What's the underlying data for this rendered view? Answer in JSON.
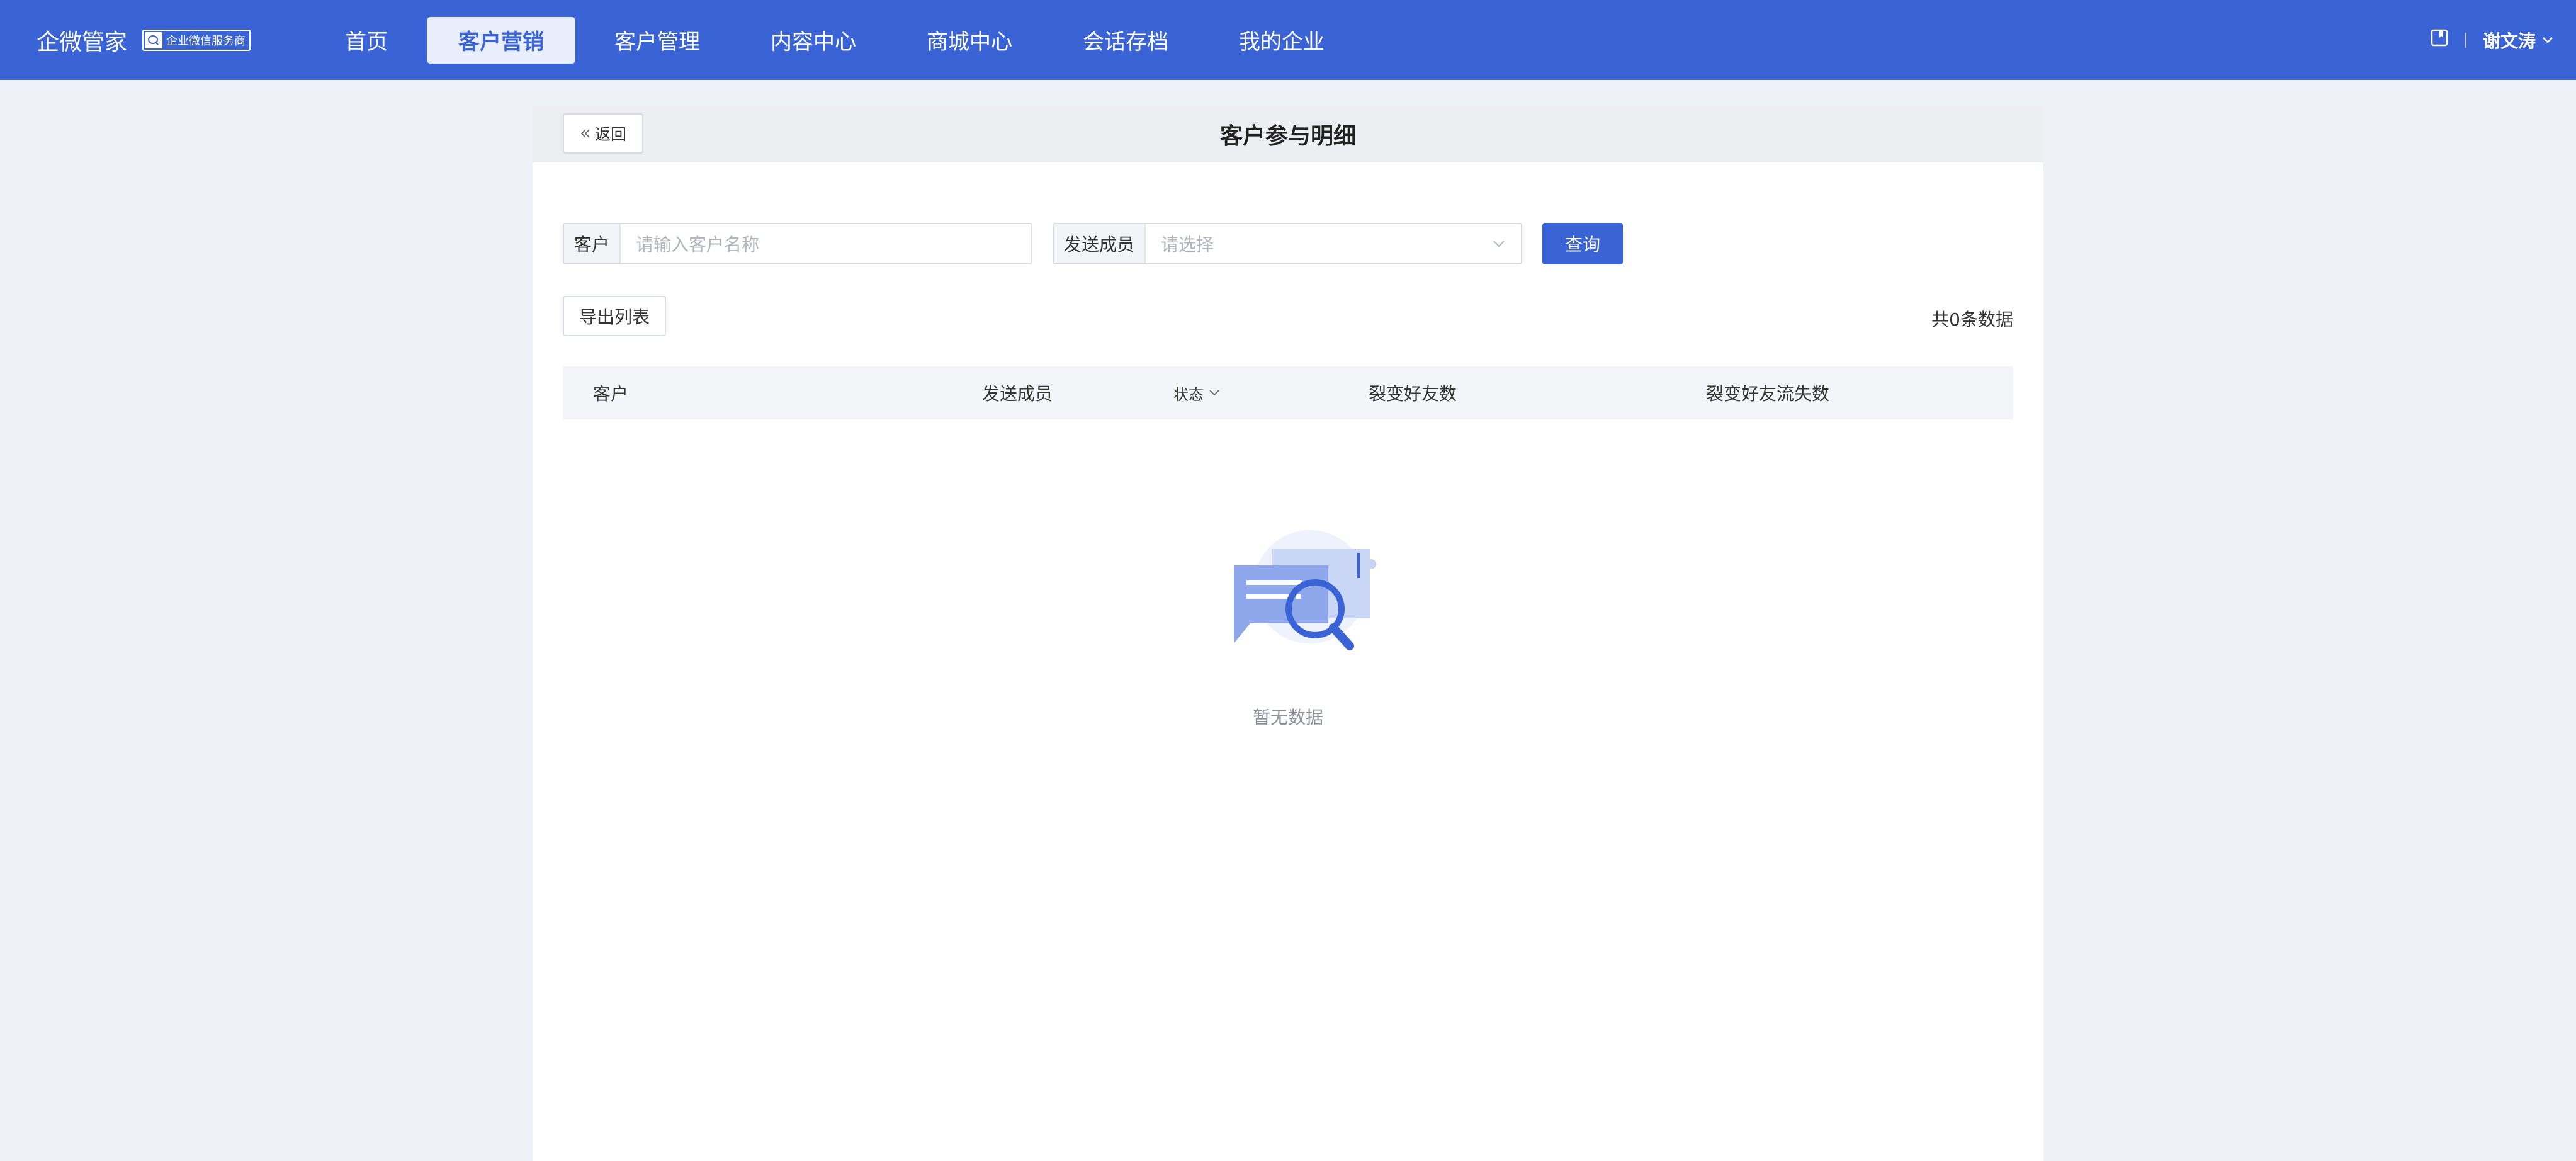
{
  "brand": {
    "name": "企微管家",
    "badge": "企业微信服务商"
  },
  "nav": {
    "items": [
      {
        "label": "首页",
        "active": false
      },
      {
        "label": "客户营销",
        "active": true
      },
      {
        "label": "客户管理",
        "active": false
      },
      {
        "label": "内容中心",
        "active": false
      },
      {
        "label": "商城中心",
        "active": false
      },
      {
        "label": "会话存档",
        "active": false
      },
      {
        "label": "我的企业",
        "active": false
      }
    ]
  },
  "user": {
    "name": "谢文涛"
  },
  "page": {
    "title": "客户参与明细",
    "back_label": "返回"
  },
  "filters": {
    "customer_label": "客户",
    "customer_placeholder": "请输入客户名称",
    "member_label": "发送成员",
    "member_placeholder": "请选择",
    "query_label": "查询"
  },
  "toolbar": {
    "export_label": "导出列表",
    "total_text": "共0条数据"
  },
  "table": {
    "columns": [
      "客户",
      "发送成员",
      "状态",
      "裂变好友数",
      "裂变好友流失数"
    ],
    "rows": []
  },
  "empty": {
    "text": "暂无数据"
  },
  "colors": {
    "primary": "#3a63d6",
    "background": "#eef1f8"
  }
}
